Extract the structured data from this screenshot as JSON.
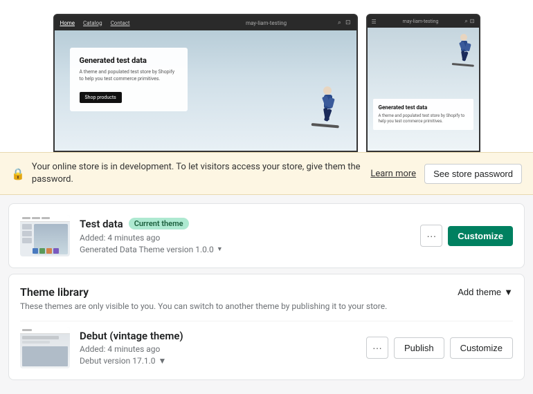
{
  "preview": {
    "desktop_nav": {
      "links": [
        "Home",
        "Catalog",
        "Contact"
      ],
      "store_name": "may-liam-testing"
    },
    "mobile_nav": {
      "store_name": "may-liam-testing"
    },
    "hero": {
      "title": "Generated test data",
      "subtitle": "A theme and populated test store by Shopify to help you test commerce primitives.",
      "cta": "Shop products"
    }
  },
  "alert": {
    "message": "Your online store is in development. To let visitors access your store, give them the password.",
    "learn_more": "Learn more",
    "store_password": "See store password"
  },
  "current_theme": {
    "name": "Test data",
    "badge": "Current theme",
    "added": "Added: 4 minutes ago",
    "version": "Generated Data Theme version 1.0.0",
    "customize": "Customize"
  },
  "library": {
    "title": "Theme library",
    "subtitle": "These themes are only visible to you. You can switch to another theme by publishing it to your store.",
    "add_theme": "Add theme",
    "theme": {
      "name": "Debut (vintage theme)",
      "added": "Added: 4 minutes ago",
      "version": "Debut version 17.1.0",
      "publish": "Publish",
      "customize": "Customize"
    }
  }
}
